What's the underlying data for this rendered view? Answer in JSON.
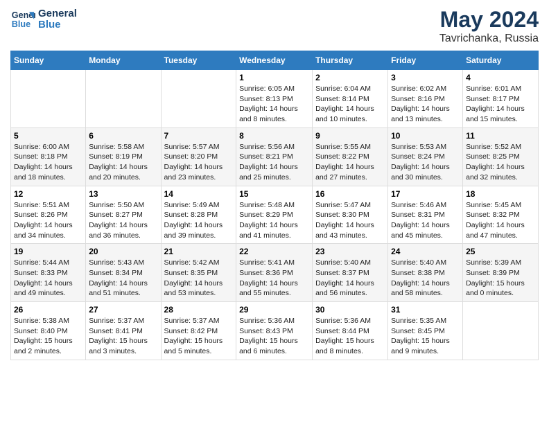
{
  "header": {
    "logo_line1": "General",
    "logo_line2": "Blue",
    "month_year": "May 2024",
    "location": "Tavrichanka, Russia"
  },
  "weekdays": [
    "Sunday",
    "Monday",
    "Tuesday",
    "Wednesday",
    "Thursday",
    "Friday",
    "Saturday"
  ],
  "weeks": [
    [
      {
        "num": "",
        "info": ""
      },
      {
        "num": "",
        "info": ""
      },
      {
        "num": "",
        "info": ""
      },
      {
        "num": "1",
        "info": "Sunrise: 6:05 AM\nSunset: 8:13 PM\nDaylight: 14 hours\nand 8 minutes."
      },
      {
        "num": "2",
        "info": "Sunrise: 6:04 AM\nSunset: 8:14 PM\nDaylight: 14 hours\nand 10 minutes."
      },
      {
        "num": "3",
        "info": "Sunrise: 6:02 AM\nSunset: 8:16 PM\nDaylight: 14 hours\nand 13 minutes."
      },
      {
        "num": "4",
        "info": "Sunrise: 6:01 AM\nSunset: 8:17 PM\nDaylight: 14 hours\nand 15 minutes."
      }
    ],
    [
      {
        "num": "5",
        "info": "Sunrise: 6:00 AM\nSunset: 8:18 PM\nDaylight: 14 hours\nand 18 minutes."
      },
      {
        "num": "6",
        "info": "Sunrise: 5:58 AM\nSunset: 8:19 PM\nDaylight: 14 hours\nand 20 minutes."
      },
      {
        "num": "7",
        "info": "Sunrise: 5:57 AM\nSunset: 8:20 PM\nDaylight: 14 hours\nand 23 minutes."
      },
      {
        "num": "8",
        "info": "Sunrise: 5:56 AM\nSunset: 8:21 PM\nDaylight: 14 hours\nand 25 minutes."
      },
      {
        "num": "9",
        "info": "Sunrise: 5:55 AM\nSunset: 8:22 PM\nDaylight: 14 hours\nand 27 minutes."
      },
      {
        "num": "10",
        "info": "Sunrise: 5:53 AM\nSunset: 8:24 PM\nDaylight: 14 hours\nand 30 minutes."
      },
      {
        "num": "11",
        "info": "Sunrise: 5:52 AM\nSunset: 8:25 PM\nDaylight: 14 hours\nand 32 minutes."
      }
    ],
    [
      {
        "num": "12",
        "info": "Sunrise: 5:51 AM\nSunset: 8:26 PM\nDaylight: 14 hours\nand 34 minutes."
      },
      {
        "num": "13",
        "info": "Sunrise: 5:50 AM\nSunset: 8:27 PM\nDaylight: 14 hours\nand 36 minutes."
      },
      {
        "num": "14",
        "info": "Sunrise: 5:49 AM\nSunset: 8:28 PM\nDaylight: 14 hours\nand 39 minutes."
      },
      {
        "num": "15",
        "info": "Sunrise: 5:48 AM\nSunset: 8:29 PM\nDaylight: 14 hours\nand 41 minutes."
      },
      {
        "num": "16",
        "info": "Sunrise: 5:47 AM\nSunset: 8:30 PM\nDaylight: 14 hours\nand 43 minutes."
      },
      {
        "num": "17",
        "info": "Sunrise: 5:46 AM\nSunset: 8:31 PM\nDaylight: 14 hours\nand 45 minutes."
      },
      {
        "num": "18",
        "info": "Sunrise: 5:45 AM\nSunset: 8:32 PM\nDaylight: 14 hours\nand 47 minutes."
      }
    ],
    [
      {
        "num": "19",
        "info": "Sunrise: 5:44 AM\nSunset: 8:33 PM\nDaylight: 14 hours\nand 49 minutes."
      },
      {
        "num": "20",
        "info": "Sunrise: 5:43 AM\nSunset: 8:34 PM\nDaylight: 14 hours\nand 51 minutes."
      },
      {
        "num": "21",
        "info": "Sunrise: 5:42 AM\nSunset: 8:35 PM\nDaylight: 14 hours\nand 53 minutes."
      },
      {
        "num": "22",
        "info": "Sunrise: 5:41 AM\nSunset: 8:36 PM\nDaylight: 14 hours\nand 55 minutes."
      },
      {
        "num": "23",
        "info": "Sunrise: 5:40 AM\nSunset: 8:37 PM\nDaylight: 14 hours\nand 56 minutes."
      },
      {
        "num": "24",
        "info": "Sunrise: 5:40 AM\nSunset: 8:38 PM\nDaylight: 14 hours\nand 58 minutes."
      },
      {
        "num": "25",
        "info": "Sunrise: 5:39 AM\nSunset: 8:39 PM\nDaylight: 15 hours\nand 0 minutes."
      }
    ],
    [
      {
        "num": "26",
        "info": "Sunrise: 5:38 AM\nSunset: 8:40 PM\nDaylight: 15 hours\nand 2 minutes."
      },
      {
        "num": "27",
        "info": "Sunrise: 5:37 AM\nSunset: 8:41 PM\nDaylight: 15 hours\nand 3 minutes."
      },
      {
        "num": "28",
        "info": "Sunrise: 5:37 AM\nSunset: 8:42 PM\nDaylight: 15 hours\nand 5 minutes."
      },
      {
        "num": "29",
        "info": "Sunrise: 5:36 AM\nSunset: 8:43 PM\nDaylight: 15 hours\nand 6 minutes."
      },
      {
        "num": "30",
        "info": "Sunrise: 5:36 AM\nSunset: 8:44 PM\nDaylight: 15 hours\nand 8 minutes."
      },
      {
        "num": "31",
        "info": "Sunrise: 5:35 AM\nSunset: 8:45 PM\nDaylight: 15 hours\nand 9 minutes."
      },
      {
        "num": "",
        "info": ""
      }
    ]
  ]
}
